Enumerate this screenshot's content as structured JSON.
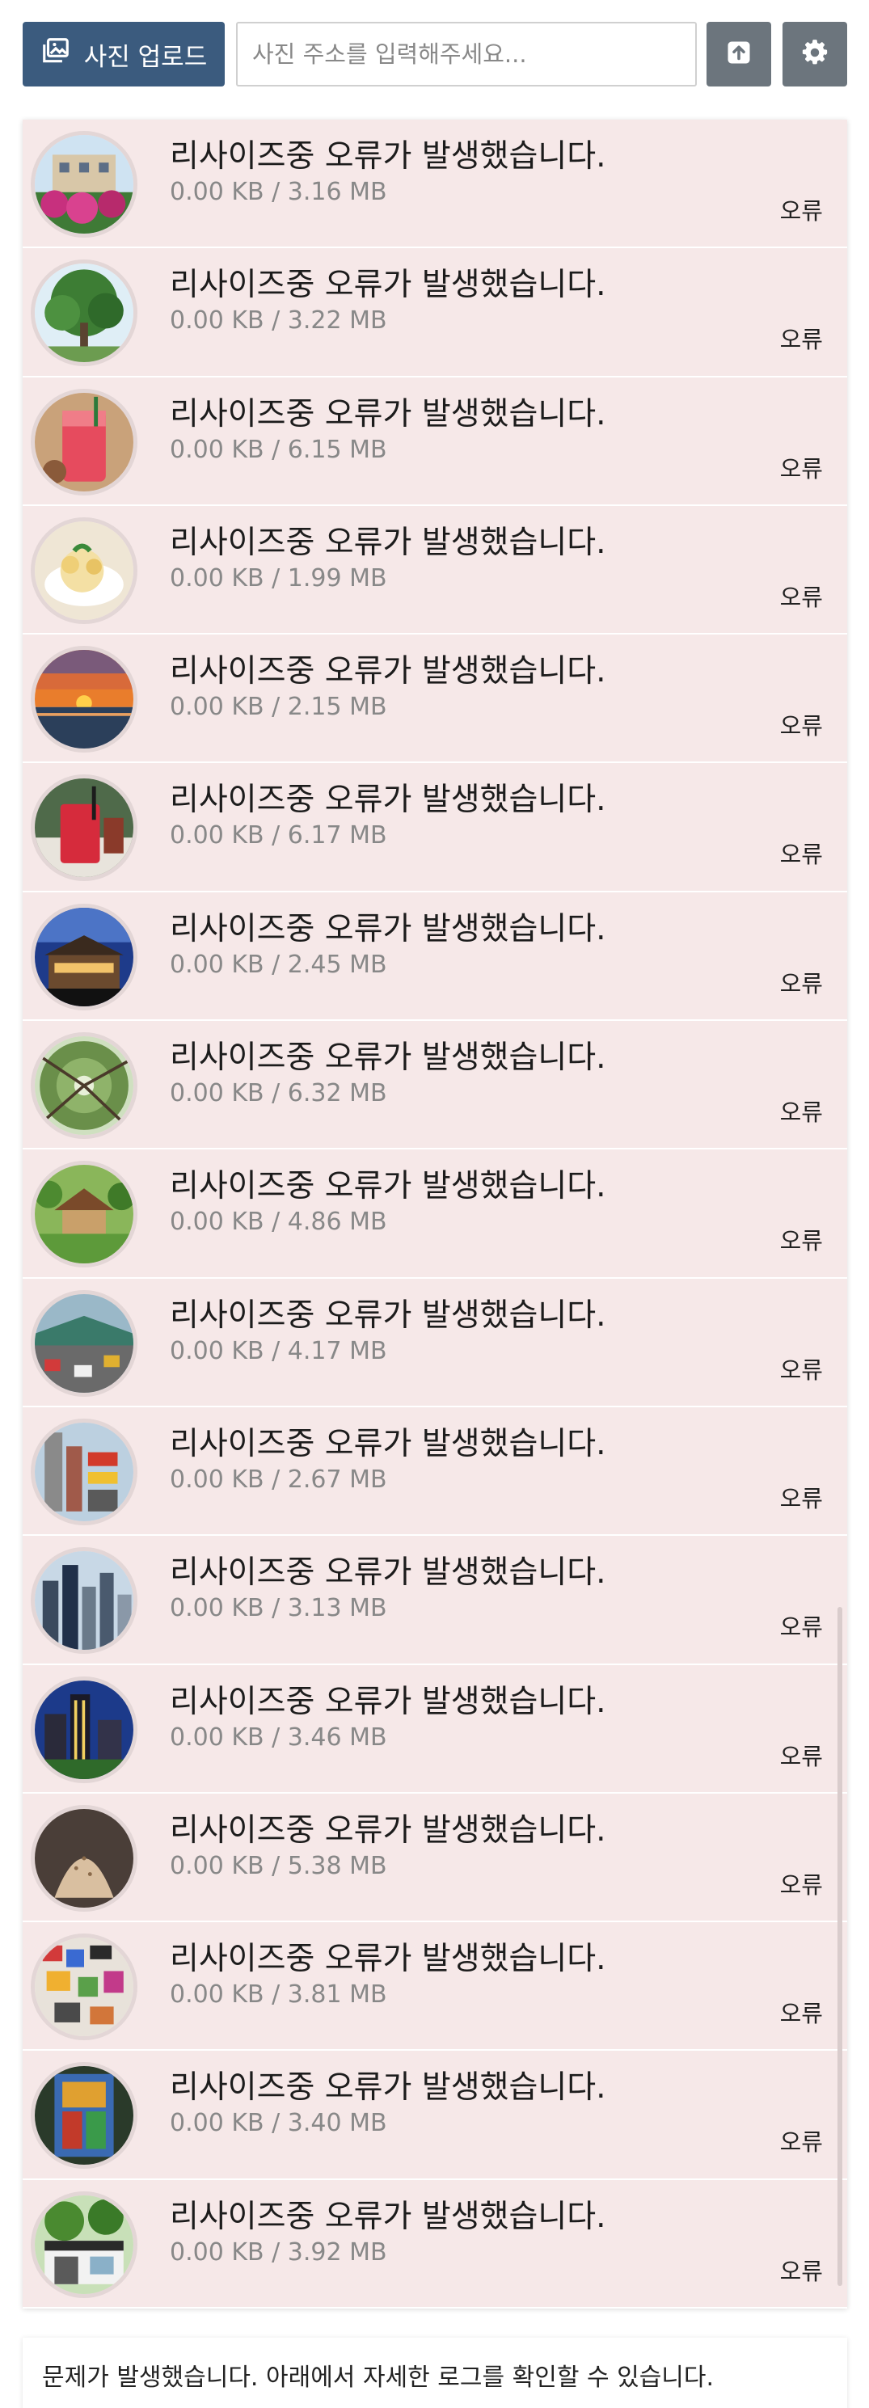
{
  "toolbar": {
    "upload_label": "사진 업로드",
    "url_placeholder": "사진 주소를 입력해주세요...",
    "upload_icon": "image-icon",
    "send_icon": "arrow-up-icon",
    "settings_icon": "gear-icon"
  },
  "items": [
    {
      "title": "리사이즈중 오류가 발생했습니다.",
      "size": "0.00 KB / 3.16 MB",
      "status": "오류",
      "thumb": "flowers-building"
    },
    {
      "title": "리사이즈중 오류가 발생했습니다.",
      "size": "0.00 KB / 3.22 MB",
      "status": "오류",
      "thumb": "tree"
    },
    {
      "title": "리사이즈중 오류가 발생했습니다.",
      "size": "0.00 KB / 6.15 MB",
      "status": "오류",
      "thumb": "red-drink"
    },
    {
      "title": "리사이즈중 오류가 발생했습니다.",
      "size": "0.00 KB / 1.99 MB",
      "status": "오류",
      "thumb": "dessert"
    },
    {
      "title": "리사이즈중 오류가 발생했습니다.",
      "size": "0.00 KB / 2.15 MB",
      "status": "오류",
      "thumb": "sunset"
    },
    {
      "title": "리사이즈중 오류가 발생했습니다.",
      "size": "0.00 KB / 6.17 MB",
      "status": "오류",
      "thumb": "red-drink-2"
    },
    {
      "title": "리사이즈중 오류가 발생했습니다.",
      "size": "0.00 KB / 2.45 MB",
      "status": "오류",
      "thumb": "night-building"
    },
    {
      "title": "리사이즈중 오류가 발생했습니다.",
      "size": "0.00 KB / 6.32 MB",
      "status": "오류",
      "thumb": "forest-canopy"
    },
    {
      "title": "리사이즈중 오류가 발생했습니다.",
      "size": "0.00 KB / 4.86 MB",
      "status": "오류",
      "thumb": "pavilion"
    },
    {
      "title": "리사이즈중 오류가 발생했습니다.",
      "size": "0.00 KB / 4.17 MB",
      "status": "오류",
      "thumb": "street"
    },
    {
      "title": "리사이즈중 오류가 발생했습니다.",
      "size": "0.00 KB / 2.67 MB",
      "status": "오류",
      "thumb": "city-signs"
    },
    {
      "title": "리사이즈중 오류가 발생했습니다.",
      "size": "0.00 KB / 3.13 MB",
      "status": "오류",
      "thumb": "skyline"
    },
    {
      "title": "리사이즈중 오류가 발생했습니다.",
      "size": "0.00 KB / 3.46 MB",
      "status": "오류",
      "thumb": "city-night"
    },
    {
      "title": "리사이즈중 오류가 발생했습니다.",
      "size": "0.00 KB / 5.38 MB",
      "status": "오류",
      "thumb": "stone"
    },
    {
      "title": "리사이즈중 오류가 발생했습니다.",
      "size": "0.00 KB / 3.81 MB",
      "status": "오류",
      "thumb": "wall-art"
    },
    {
      "title": "리사이즈중 오류가 발생했습니다.",
      "size": "0.00 KB / 3.40 MB",
      "status": "오류",
      "thumb": "stained-glass"
    },
    {
      "title": "리사이즈중 오류가 발생했습니다.",
      "size": "0.00 KB / 3.92 MB",
      "status": "오류",
      "thumb": "shop-front"
    }
  ],
  "footer": {
    "message": "문제가 발생했습니다. 아래에서 자세한 로그를 확인할 수 있습니다."
  },
  "colors": {
    "primary": "#3b5b7e",
    "secondary": "#6c757d",
    "error_bg": "#f6e8e8"
  }
}
